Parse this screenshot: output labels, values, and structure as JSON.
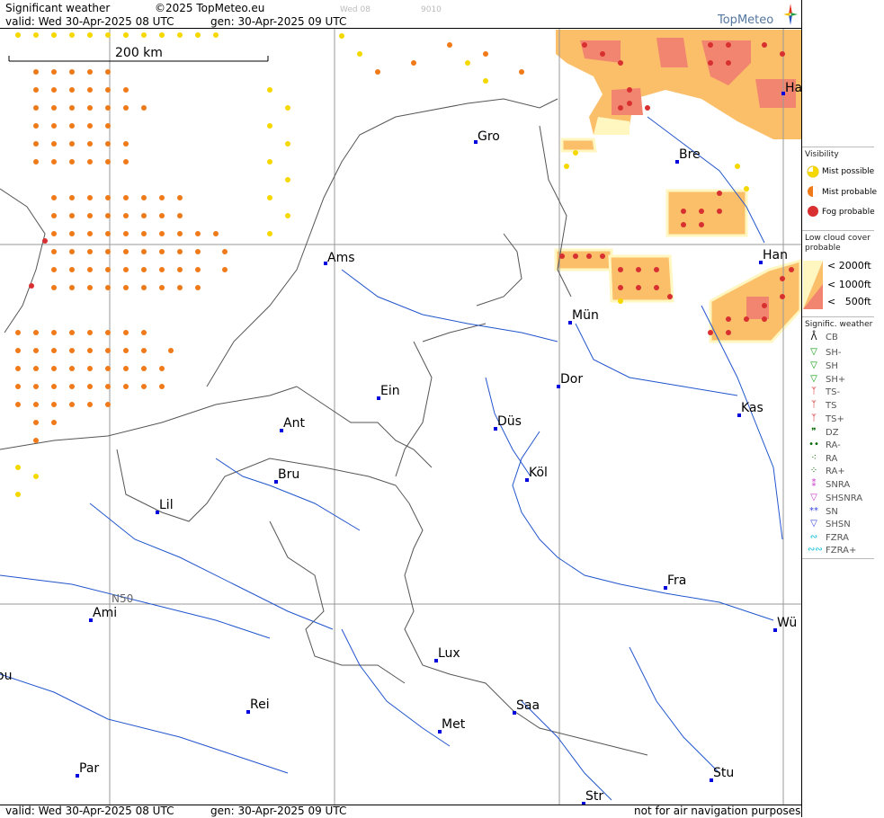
{
  "header": {
    "title": "Significant weather",
    "copyright": "©2025 TopMeteo.eu",
    "valid": "valid:  Wed  30-Apr-2025  08 UTC",
    "gen": "gen: 30-Apr-2025 09 UTC",
    "faint_day": "Wed 08",
    "faint_code": "9010",
    "logo": "TopMeteo"
  },
  "footer": {
    "valid": "valid:  Wed  30-Apr-2025  08 UTC",
    "gen": "gen: 30-Apr-2025 09 UTC",
    "note": "not for air navigation purposes"
  },
  "map": {
    "scale_label": "200 km",
    "lat_label": "N50",
    "cities": [
      {
        "name": "Gro"
      },
      {
        "name": "Bre"
      },
      {
        "name": "Ha"
      },
      {
        "name": "Ams"
      },
      {
        "name": "Han"
      },
      {
        "name": "Mün"
      },
      {
        "name": "Dor"
      },
      {
        "name": "Ein"
      },
      {
        "name": "Kas"
      },
      {
        "name": "Düs"
      },
      {
        "name": "Ant"
      },
      {
        "name": "Köl"
      },
      {
        "name": "Bru"
      },
      {
        "name": "Lil"
      },
      {
        "name": "Fra"
      },
      {
        "name": "Ami"
      },
      {
        "name": "Wü"
      },
      {
        "name": "Lux"
      },
      {
        "name": "ou"
      },
      {
        "name": "Rei"
      },
      {
        "name": "Saa"
      },
      {
        "name": "Met"
      },
      {
        "name": "Par"
      },
      {
        "name": "Stu"
      },
      {
        "name": "Str"
      }
    ]
  },
  "legend": {
    "visibility_title": "Visibility",
    "visibility": [
      {
        "label": "Mist possible",
        "color": "#f5d800"
      },
      {
        "label": "Mist probable",
        "color": "#f07a1a"
      },
      {
        "label": "Fog probable",
        "color": "#d83030"
      }
    ],
    "cloud_title": "Low cloud cover probable",
    "cloud": [
      {
        "label": "< 2000ft",
        "color": "#fff6c0"
      },
      {
        "label": "< 1000ft",
        "color": "#fbbf6a"
      },
      {
        "label": "<   500ft",
        "color": "#f28570"
      }
    ],
    "sigwx_title": "Signific. weather",
    "sigwx": [
      {
        "label": "CB",
        "icon": "cb-icon",
        "color": "#000000"
      },
      {
        "label": "SH-",
        "icon": "shower-light-icon",
        "color": "#009900"
      },
      {
        "label": "SH",
        "icon": "shower-icon",
        "color": "#009900"
      },
      {
        "label": "SH+",
        "icon": "shower-heavy-icon",
        "color": "#009900"
      },
      {
        "label": "TS-",
        "icon": "thunder-light-icon",
        "color": "#cc0000"
      },
      {
        "label": "TS",
        "icon": "thunder-icon",
        "color": "#cc0000"
      },
      {
        "label": "TS+",
        "icon": "thunder-heavy-icon",
        "color": "#cc0000"
      },
      {
        "label": "DZ",
        "icon": "drizzle-icon",
        "color": "#006600"
      },
      {
        "label": "RA-",
        "icon": "rain-light-icon",
        "color": "#006600"
      },
      {
        "label": "RA",
        "icon": "rain-icon",
        "color": "#006600"
      },
      {
        "label": "RA+",
        "icon": "rain-heavy-icon",
        "color": "#006600"
      },
      {
        "label": "SNRA",
        "icon": "snow-rain-icon",
        "color": "#cc33cc"
      },
      {
        "label": "SHSNRA",
        "icon": "snow-rain-shower-icon",
        "color": "#cc33cc"
      },
      {
        "label": "SN",
        "icon": "snow-icon",
        "color": "#3344dd"
      },
      {
        "label": "SHSN",
        "icon": "snow-shower-icon",
        "color": "#3344dd"
      },
      {
        "label": "FZRA",
        "icon": "freezing-rain-icon",
        "color": "#00bbdd"
      },
      {
        "label": "FZRA+",
        "icon": "freezing-rain-heavy-icon",
        "color": "#00bbdd"
      }
    ]
  }
}
